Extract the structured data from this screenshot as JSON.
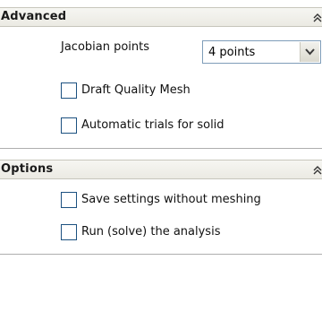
{
  "advanced": {
    "title": "Advanced",
    "collapse_icon": "double-chevron-up-icon",
    "jacobian_label": "Jacobian points",
    "jacobian_value": "4 points",
    "draft_quality_label": "Draft Quality Mesh",
    "draft_quality_checked": false,
    "automatic_trials_label": "Automatic trials for solid",
    "automatic_trials_checked": false
  },
  "options": {
    "title": "Options",
    "collapse_icon": "double-chevron-up-icon",
    "save_settings_label": "Save settings without meshing",
    "save_settings_checked": false,
    "run_analysis_label": "Run (solve) the analysis",
    "run_analysis_checked": false
  },
  "colors": {
    "header_bg": "#ebeae3",
    "checkbox_border": "#1c5180",
    "select_border": "#7f9db9"
  }
}
